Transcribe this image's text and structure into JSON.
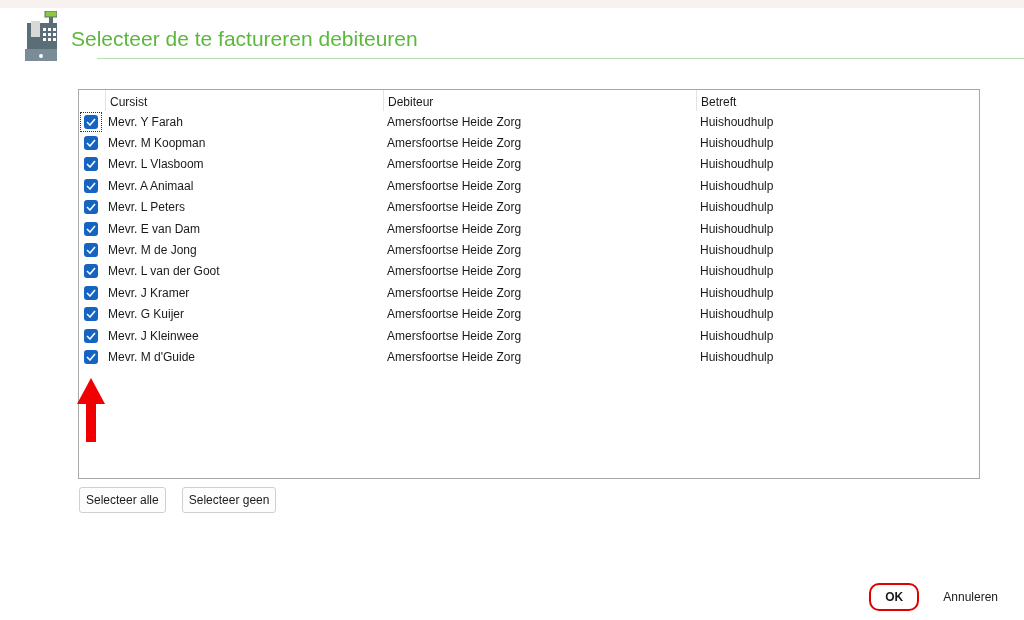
{
  "dialog": {
    "title": "Selecteer de te factureren debiteuren"
  },
  "table": {
    "columns": [
      "Cursist",
      "Debiteur",
      "Betreft"
    ],
    "rows": [
      {
        "checked": true,
        "focused": true,
        "cells": [
          "Mevr. Y Farah",
          "Amersfoortse Heide Zorg",
          "Huishoudhulp"
        ]
      },
      {
        "checked": true,
        "focused": false,
        "cells": [
          "Mevr. M Koopman",
          "Amersfoortse Heide Zorg",
          "Huishoudhulp"
        ]
      },
      {
        "checked": true,
        "focused": false,
        "cells": [
          "Mevr. L Vlasboom",
          "Amersfoortse Heide Zorg",
          "Huishoudhulp"
        ]
      },
      {
        "checked": true,
        "focused": false,
        "cells": [
          "Mevr. A Animaal",
          "Amersfoortse Heide Zorg",
          "Huishoudhulp"
        ]
      },
      {
        "checked": true,
        "focused": false,
        "cells": [
          "Mevr. L Peters",
          "Amersfoortse Heide Zorg",
          "Huishoudhulp"
        ]
      },
      {
        "checked": true,
        "focused": false,
        "cells": [
          "Mevr. E van Dam",
          "Amersfoortse Heide Zorg",
          "Huishoudhulp"
        ]
      },
      {
        "checked": true,
        "focused": false,
        "cells": [
          "Mevr. M de Jong",
          "Amersfoortse Heide Zorg",
          "Huishoudhulp"
        ]
      },
      {
        "checked": true,
        "focused": false,
        "cells": [
          "Mevr. L van der Goot",
          "Amersfoortse Heide Zorg",
          "Huishoudhulp"
        ]
      },
      {
        "checked": true,
        "focused": false,
        "cells": [
          "Mevr. J Kramer",
          "Amersfoortse Heide Zorg",
          "Huishoudhulp"
        ]
      },
      {
        "checked": true,
        "focused": false,
        "cells": [
          "Mevr. G Kuijer",
          "Amersfoortse Heide Zorg",
          "Huishoudhulp"
        ]
      },
      {
        "checked": true,
        "focused": false,
        "cells": [
          "Mevr. J Kleinwee",
          "Amersfoortse Heide Zorg",
          "Huishoudhulp"
        ]
      },
      {
        "checked": true,
        "focused": false,
        "cells": [
          "Mevr. M d'Guide",
          "Amersfoortse Heide Zorg",
          "Huishoudhulp"
        ]
      }
    ]
  },
  "selection_buttons": [
    "Selecteer alle",
    "Selecteer geen"
  ],
  "footer_buttons": [
    {
      "label": "OK",
      "kind": "default",
      "highlighted": true
    },
    {
      "label": "Annuleren",
      "kind": "flat",
      "highlighted": false
    }
  ]
}
